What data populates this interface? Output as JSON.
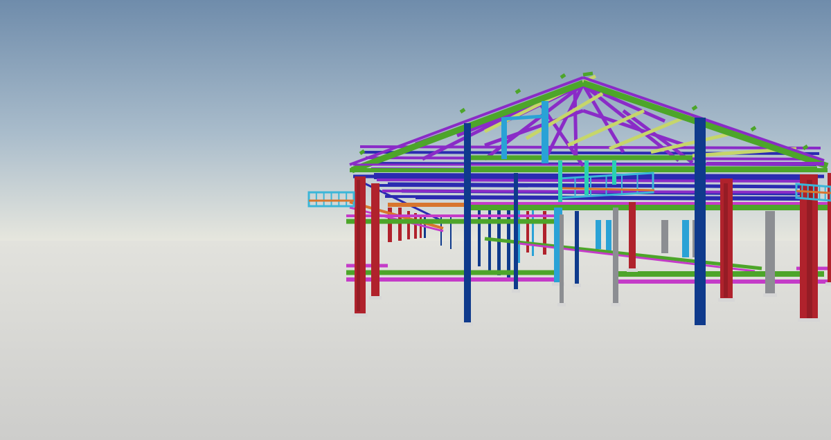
{
  "viewport": {
    "type": "3d-model-viewer",
    "model": "steel-frame-structure"
  },
  "colors": {
    "sky_top": "#6f8cab",
    "sky_mid": "#a9bccb",
    "horizon": "#e7e7de",
    "ground_near": "#cdcdcb",
    "ground_far": "#e2e2dd",
    "column_red": "#b0222c",
    "column_blue": "#0f3a8c",
    "column_cyan": "#2aa2d6",
    "column_grey": "#8c8e92",
    "rafter_green": "#4da52a",
    "brace_purple": "#8a2bc7",
    "beam_magenta": "#c43bc8",
    "purlin_navy": "#2a2bb0",
    "purlin_yellow": "#c6d66a",
    "beam_orange": "#d8752e",
    "tray_cyan": "#3bb6d8",
    "tray_teal": "#2ad0b4",
    "base_plate": "#d6d6d6"
  }
}
